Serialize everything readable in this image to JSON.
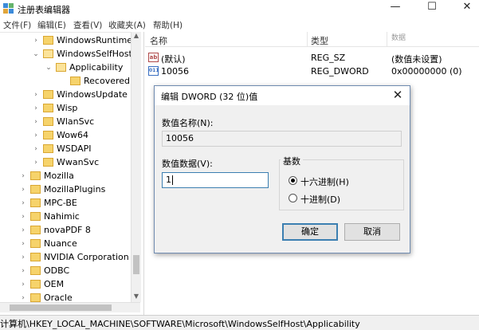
{
  "window": {
    "title": "注册表编辑器",
    "controls": {
      "minimize": "—",
      "maximize": "☐",
      "close": "✕"
    }
  },
  "menu": [
    "文件(F)",
    "编辑(E)",
    "查看(V)",
    "收藏夹(A)",
    "帮助(H)"
  ],
  "tree": [
    {
      "label": "WindowsRuntime",
      "expander": "›"
    },
    {
      "label": "WindowsSelfHost",
      "expander": "⌄"
    },
    {
      "label": "Applicability",
      "expander": "⌄"
    },
    {
      "label": "RecoveredFr",
      "expander": ""
    },
    {
      "label": "WindowsUpdate",
      "expander": "›"
    },
    {
      "label": "Wisp",
      "expander": "›"
    },
    {
      "label": "WlanSvc",
      "expander": "›"
    },
    {
      "label": "Wow64",
      "expander": "›"
    },
    {
      "label": "WSDAPI",
      "expander": "›"
    },
    {
      "label": "WwanSvc",
      "expander": "›"
    },
    {
      "label": "Mozilla",
      "expander": "›"
    },
    {
      "label": "MozillaPlugins",
      "expander": "›"
    },
    {
      "label": "MPC-BE",
      "expander": "›"
    },
    {
      "label": "Nahimic",
      "expander": "›"
    },
    {
      "label": "novaPDF 8",
      "expander": "›"
    },
    {
      "label": "Nuance",
      "expander": "›"
    },
    {
      "label": "NVIDIA Corporation",
      "expander": "›"
    },
    {
      "label": "ODBC",
      "expander": "›"
    },
    {
      "label": "OEM",
      "expander": "›"
    },
    {
      "label": "Oracle",
      "expander": "›"
    }
  ],
  "list": {
    "headers": {
      "name": "名称",
      "type": "类型",
      "data": "数据"
    },
    "rows": [
      {
        "icon": "ab",
        "name": "(默认)",
        "type": "REG_SZ",
        "data": "(数值未设置)"
      },
      {
        "icon": "011",
        "name": "10056",
        "type": "REG_DWORD",
        "data": "0x00000000 (0)"
      }
    ]
  },
  "status": {
    "path": "计算机\\HKEY_LOCAL_MACHINE\\SOFTWARE\\Microsoft\\WindowsSelfHost\\Applicability"
  },
  "dialog": {
    "title": "编辑 DWORD (32 位)值",
    "close": "✕",
    "name_label": "数值名称(N):",
    "name_value": "10056",
    "data_label": "数值数据(V):",
    "data_value": "1",
    "base_label": "基数",
    "radio_hex": "十六进制(H)",
    "radio_dec": "十进制(D)",
    "selected_base": "hex",
    "ok": "确定",
    "cancel": "取消"
  }
}
